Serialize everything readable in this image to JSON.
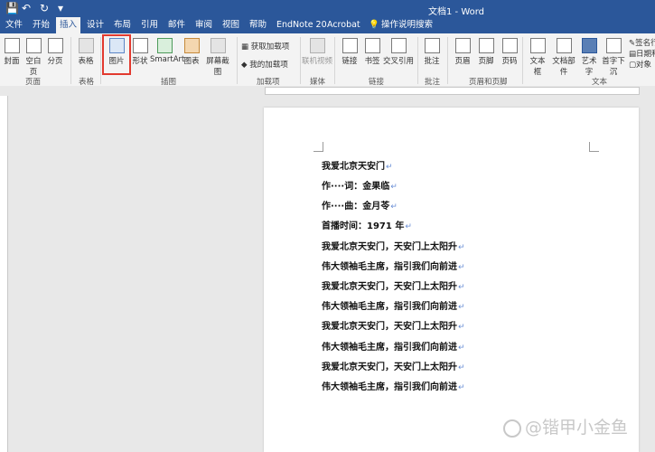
{
  "window": {
    "title": "文档1 - Word"
  },
  "quick_access": {
    "save": "💾",
    "undo": "↶",
    "redo": "↻",
    "more": "▾"
  },
  "tabs": [
    "文件",
    "开始",
    "插入",
    "设计",
    "布局",
    "引用",
    "邮件",
    "审阅",
    "视图",
    "帮助",
    "EndNote 20",
    "Acrobat",
    "操作说明搜索"
  ],
  "active_tab": "插入",
  "ribbon": {
    "cover": "封面",
    "blank": "空白页",
    "pagebreak": "分页",
    "table": "表格",
    "picture": "图片",
    "shapes": "形状",
    "smartart": "SmartArt",
    "chart": "图表",
    "screenshot": "屏幕截图",
    "get_addins": "获取加载项",
    "my_addins": "我的加载项",
    "online_video": "联机视频",
    "link": "链接",
    "bookmark": "书签",
    "crossref": "交叉引用",
    "comment": "批注",
    "header": "页眉",
    "footer": "页脚",
    "pagenum": "页码",
    "textbox": "文本框",
    "quickparts": "文档部件",
    "wordart": "艺术字",
    "dropcap": "首字下沉",
    "sigline": "签名行",
    "datetime": "日期和",
    "object": "对象",
    "groups": {
      "pages": "页面",
      "tables": "表格",
      "illustrations": "插图",
      "addins": "加载项",
      "media": "媒体",
      "links": "链接",
      "comments": "批注",
      "headerfooter": "页眉和页脚",
      "text": "文本"
    }
  },
  "document": {
    "lines": [
      "我爱北京天安门",
      "作····词：金果临",
      "作····曲：金月苓",
      "首播时间：1971 年",
      "我爱北京天安门，天安门上太阳升",
      "伟大领袖毛主席，指引我们向前进",
      "我爱北京天安门，天安门上太阳升",
      "伟大领袖毛主席，指引我们向前进",
      "我爱北京天安门，天安门上太阳升",
      "伟大领袖毛主席，指引我们向前进",
      "我爱北京天安门，天安门上太阳升",
      "伟大领袖毛主席，指引我们向前进"
    ],
    "para_mark": "↵"
  },
  "watermark": "@锴甲小金鱼"
}
